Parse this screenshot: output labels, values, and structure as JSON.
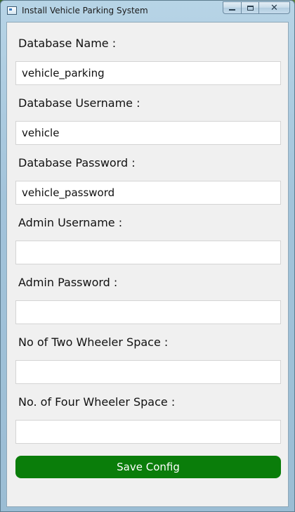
{
  "window": {
    "title": "Install Vehicle Parking System",
    "controls": {
      "minimize_icon": "minimize-icon",
      "maximize_icon": "maximize-icon",
      "close_label": "✕"
    }
  },
  "form": {
    "fields": [
      {
        "label": "Database Name :",
        "value": "vehicle_parking",
        "placeholder": ""
      },
      {
        "label": "Database Username :",
        "value": "vehicle",
        "placeholder": ""
      },
      {
        "label": "Database Password :",
        "value": "vehicle_password",
        "placeholder": ""
      },
      {
        "label": "Admin Username :",
        "value": "",
        "placeholder": ""
      },
      {
        "label": "Admin Password :",
        "value": "",
        "placeholder": ""
      },
      {
        "label": "No of Two Wheeler Space :",
        "value": "",
        "placeholder": ""
      },
      {
        "label": "No. of Four Wheeler Space :",
        "value": "",
        "placeholder": ""
      }
    ],
    "save_label": "Save Config"
  },
  "colors": {
    "accent": "#0a7d0a",
    "client_bg": "#f0f0f0",
    "titlebar": "#a2c3da"
  }
}
